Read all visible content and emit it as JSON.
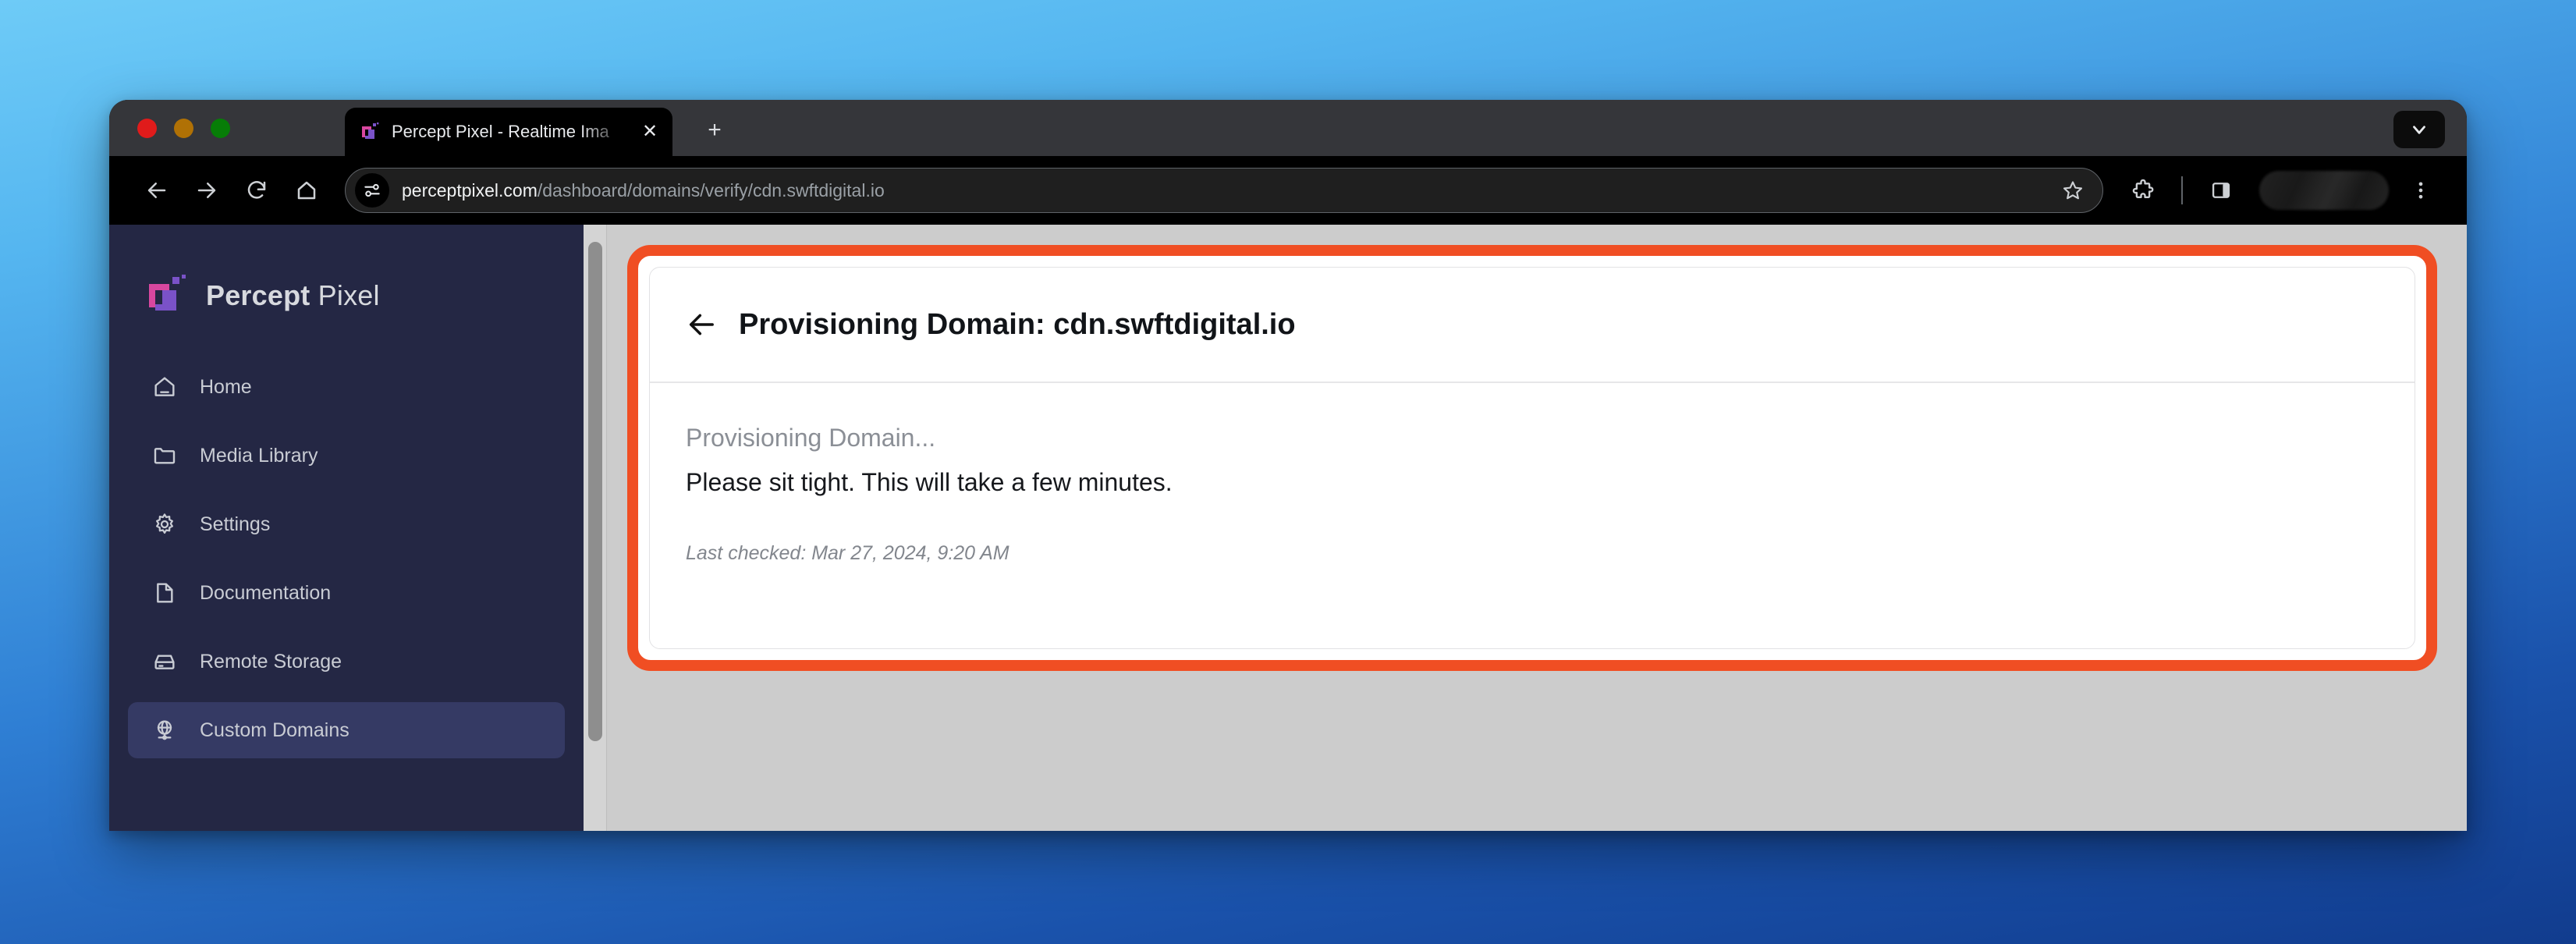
{
  "browser": {
    "tab": {
      "title": "Percept Pixel - Realtime Ima",
      "favicon": "percept-pixel-logo-icon",
      "close_label": "✕"
    },
    "new_tab_label": "+",
    "tabstrip_chevron": "chevron-down-icon",
    "toolbar": {
      "back": "back-arrow-icon",
      "forward": "forward-arrow-icon",
      "reload": "reload-icon",
      "home": "home-icon",
      "site_info": "site-settings-icon",
      "url_host": "perceptpixel.com",
      "url_path": "/dashboard/domains/verify/cdn.swftdigital.io",
      "bookmark": "star-icon",
      "extensions": "puzzle-piece-icon",
      "side_panel": "side-panel-icon",
      "profile": "profile-avatar",
      "menu": "three-dot-menu-icon"
    }
  },
  "sidebar": {
    "brand": {
      "name_bold": "Percept",
      "name_light": "Pixel",
      "mark": "percept-pixel-logo-icon"
    },
    "items": [
      {
        "label": "Home",
        "icon": "house-icon",
        "active": false
      },
      {
        "label": "Media Library",
        "icon": "folder-icon",
        "active": false
      },
      {
        "label": "Settings",
        "icon": "gear-icon",
        "active": false
      },
      {
        "label": "Documentation",
        "icon": "document-icon",
        "active": false
      },
      {
        "label": "Remote Storage",
        "icon": "hard-drive-icon",
        "active": false
      },
      {
        "label": "Custom Domains",
        "icon": "globe-stand-icon",
        "active": true
      }
    ]
  },
  "main": {
    "highlight_color": "#f04e23",
    "card": {
      "back_icon": "back-arrow-icon",
      "title": "Provisioning Domain: cdn.swftdigital.io",
      "status": "Provisioning Domain...",
      "message": "Please sit tight. This will take a few minutes.",
      "last_checked": "Last checked: Mar 27, 2024, 9:20 AM"
    }
  },
  "colors": {
    "brand_pink": "#d8479f",
    "brand_purple": "#7a52c8",
    "sidebar_bg": "#242744",
    "sidebar_active": "#353a64",
    "accent_orange": "#f04e23",
    "page_bg": "#cccccc"
  }
}
